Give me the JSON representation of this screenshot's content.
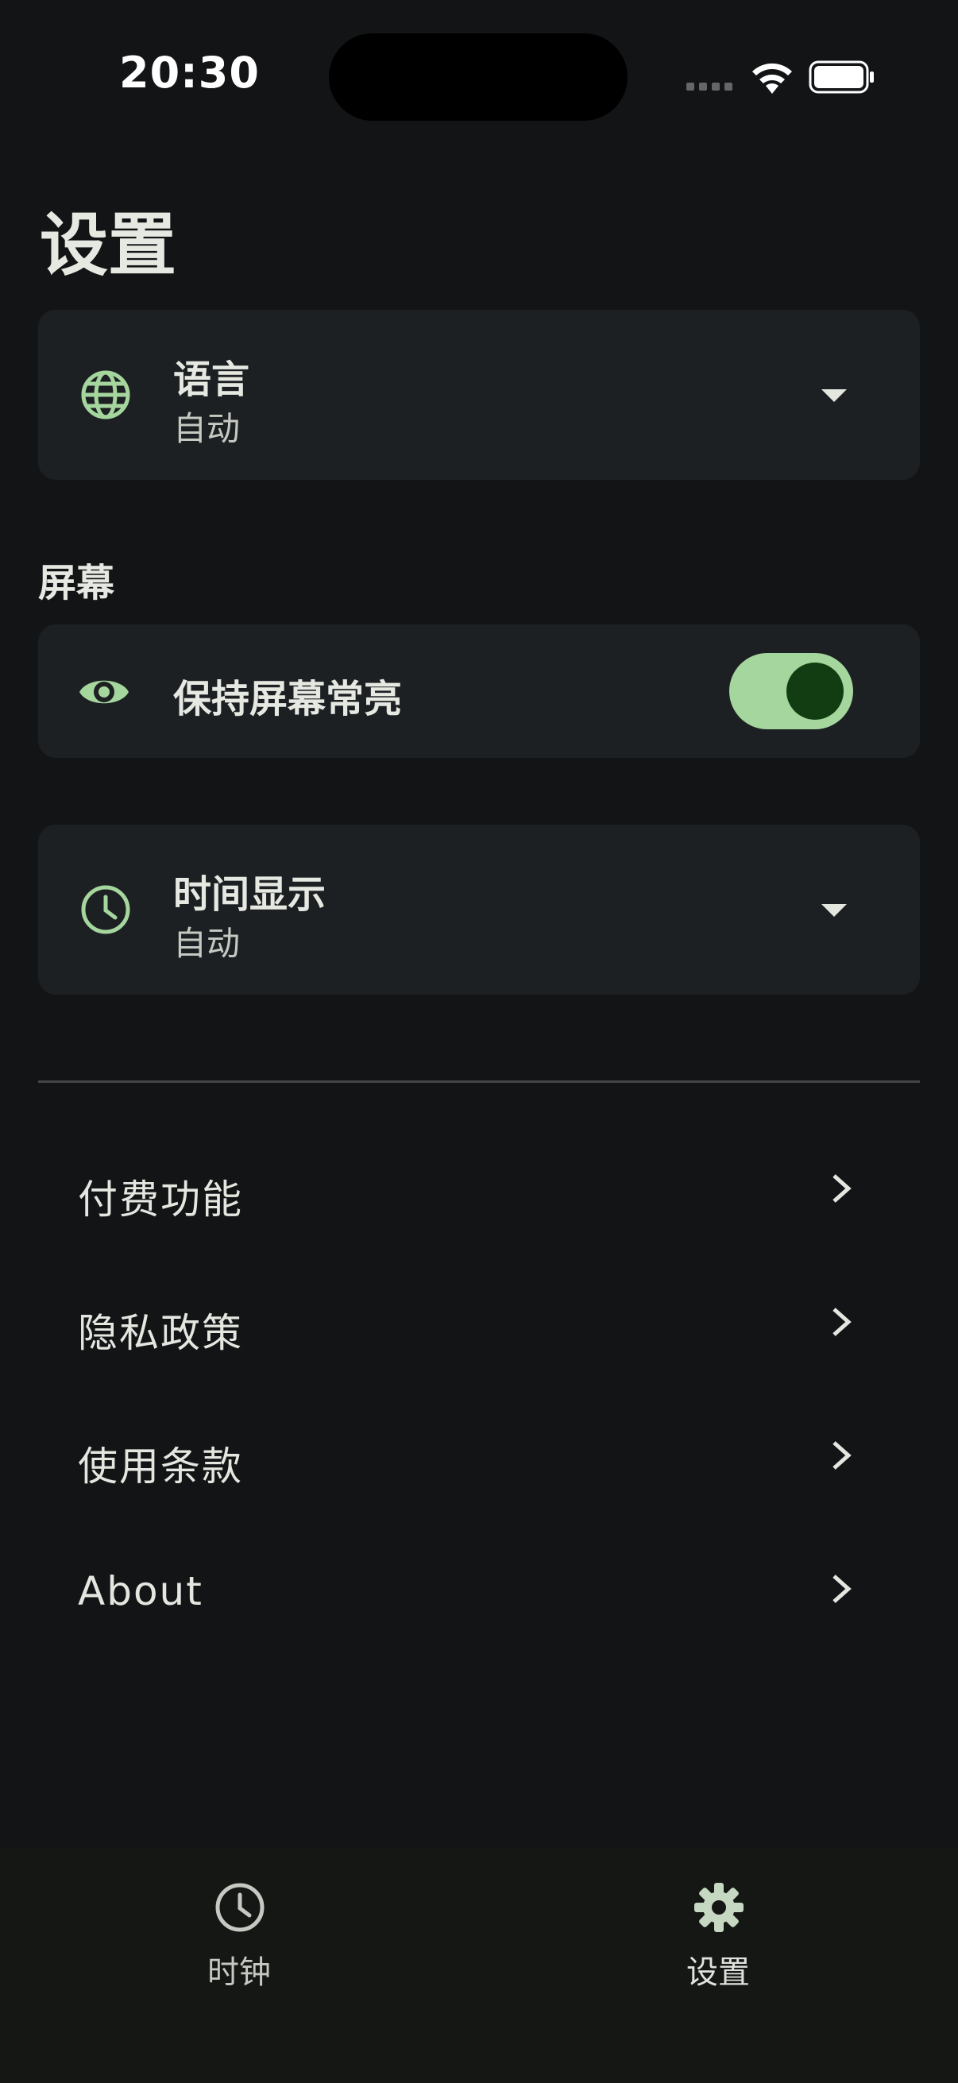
{
  "status_bar": {
    "time": "20:30"
  },
  "page": {
    "title": "设置"
  },
  "language": {
    "label": "语言",
    "value": "自动",
    "icon": "globe-icon"
  },
  "screen_section": {
    "title": "屏幕"
  },
  "keep_screen_on": {
    "label": "保持屏幕常亮",
    "enabled": true,
    "icon": "eye-icon"
  },
  "time_display": {
    "label": "时间显示",
    "value": "自动",
    "icon": "clock-icon"
  },
  "menu": [
    {
      "label": "付费功能"
    },
    {
      "label": "隐私政策"
    },
    {
      "label": "使用条款"
    },
    {
      "label": "About"
    }
  ],
  "bottom_nav": {
    "items": [
      {
        "label": "时钟",
        "icon": "clock-icon",
        "selected": false
      },
      {
        "label": "设置",
        "icon": "gear-icon",
        "selected": true
      }
    ]
  },
  "colors": {
    "background": "#121416",
    "card": "#1d2023",
    "accent": "#a5d69e",
    "toggle_knob": "#123d12"
  }
}
